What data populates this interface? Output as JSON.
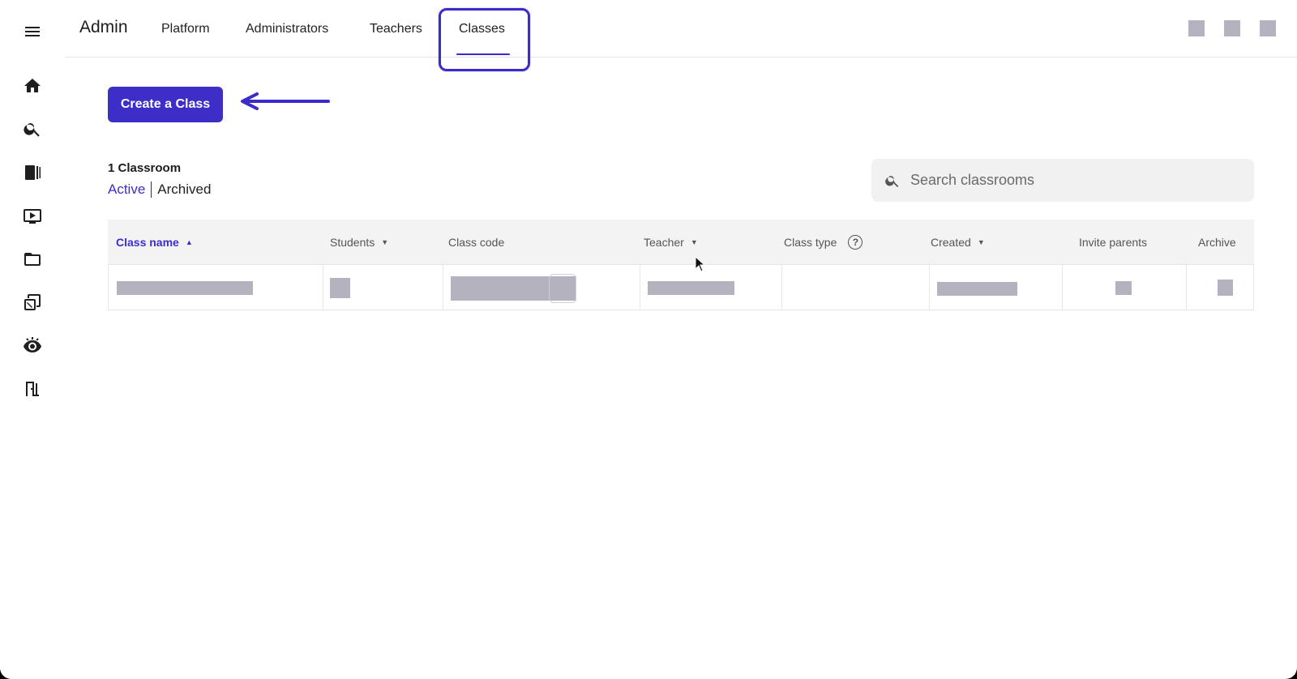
{
  "app": {
    "title": "Admin"
  },
  "nav": {
    "tabs": [
      {
        "label": "Platform"
      },
      {
        "label": "Administrators"
      },
      {
        "label": "Teachers"
      },
      {
        "label": "Classes",
        "active": true
      }
    ]
  },
  "sidebar": {
    "icons": [
      "menu-icon",
      "home-icon",
      "search-icon",
      "library-icon",
      "video-icon",
      "folder-icon",
      "assignment-icon",
      "preview-icon",
      "exit-icon"
    ]
  },
  "actions": {
    "create_label": "Create a Class"
  },
  "summary": {
    "count_label": "1 Classroom",
    "active_label": "Active",
    "archived_label": "Archived"
  },
  "search": {
    "placeholder": "Search classrooms"
  },
  "table": {
    "columns": [
      {
        "label": "Class name",
        "sort": "asc"
      },
      {
        "label": "Students",
        "sort": "desc"
      },
      {
        "label": "Class code"
      },
      {
        "label": "Teacher",
        "sort": "desc"
      },
      {
        "label": "Class type",
        "help": true
      },
      {
        "label": "Created",
        "sort": "desc"
      },
      {
        "label": "Invite parents"
      },
      {
        "label": "Archive"
      }
    ],
    "sort_asc_glyph": "▲",
    "sort_desc_glyph": "▼",
    "help_glyph": "?"
  },
  "colors": {
    "accent": "#3d2ec8",
    "placeholder_block": "#b3b2be"
  }
}
